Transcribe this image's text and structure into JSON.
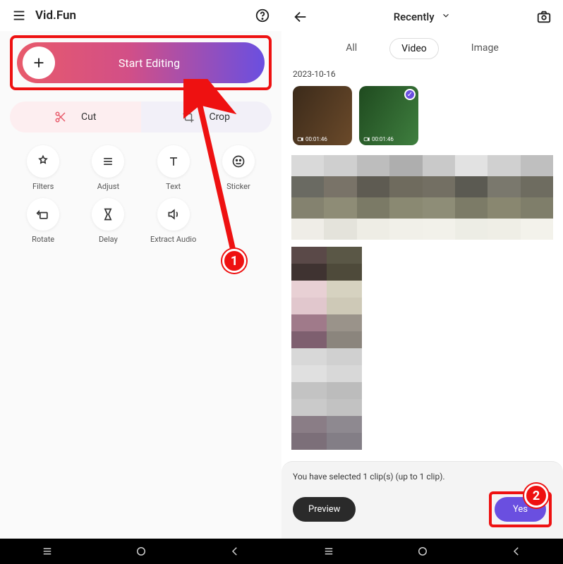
{
  "left": {
    "app_title": "Vid.Fun",
    "start_button_label": "Start Editing",
    "cut_label": "Cut",
    "crop_label": "Crop",
    "tools": [
      {
        "label": "Filters"
      },
      {
        "label": "Adjust"
      },
      {
        "label": "Text"
      },
      {
        "label": "Sticker"
      },
      {
        "label": "Rotate"
      },
      {
        "label": "Delay"
      },
      {
        "label": "Extract Audio"
      }
    ]
  },
  "right": {
    "picker_label": "Recently",
    "tabs": {
      "all": "All",
      "video": "Video",
      "image": "Image"
    },
    "section_date": "2023-10-16",
    "thumbs": [
      {
        "duration": "00:01:46"
      },
      {
        "duration": "00:01:46"
      }
    ],
    "sheet_text": "You have selected 1 clip(s) (up to 1 clip).",
    "preview_label": "Preview",
    "yes_label": "Yes"
  },
  "steps": {
    "one": "1",
    "two": "2"
  }
}
